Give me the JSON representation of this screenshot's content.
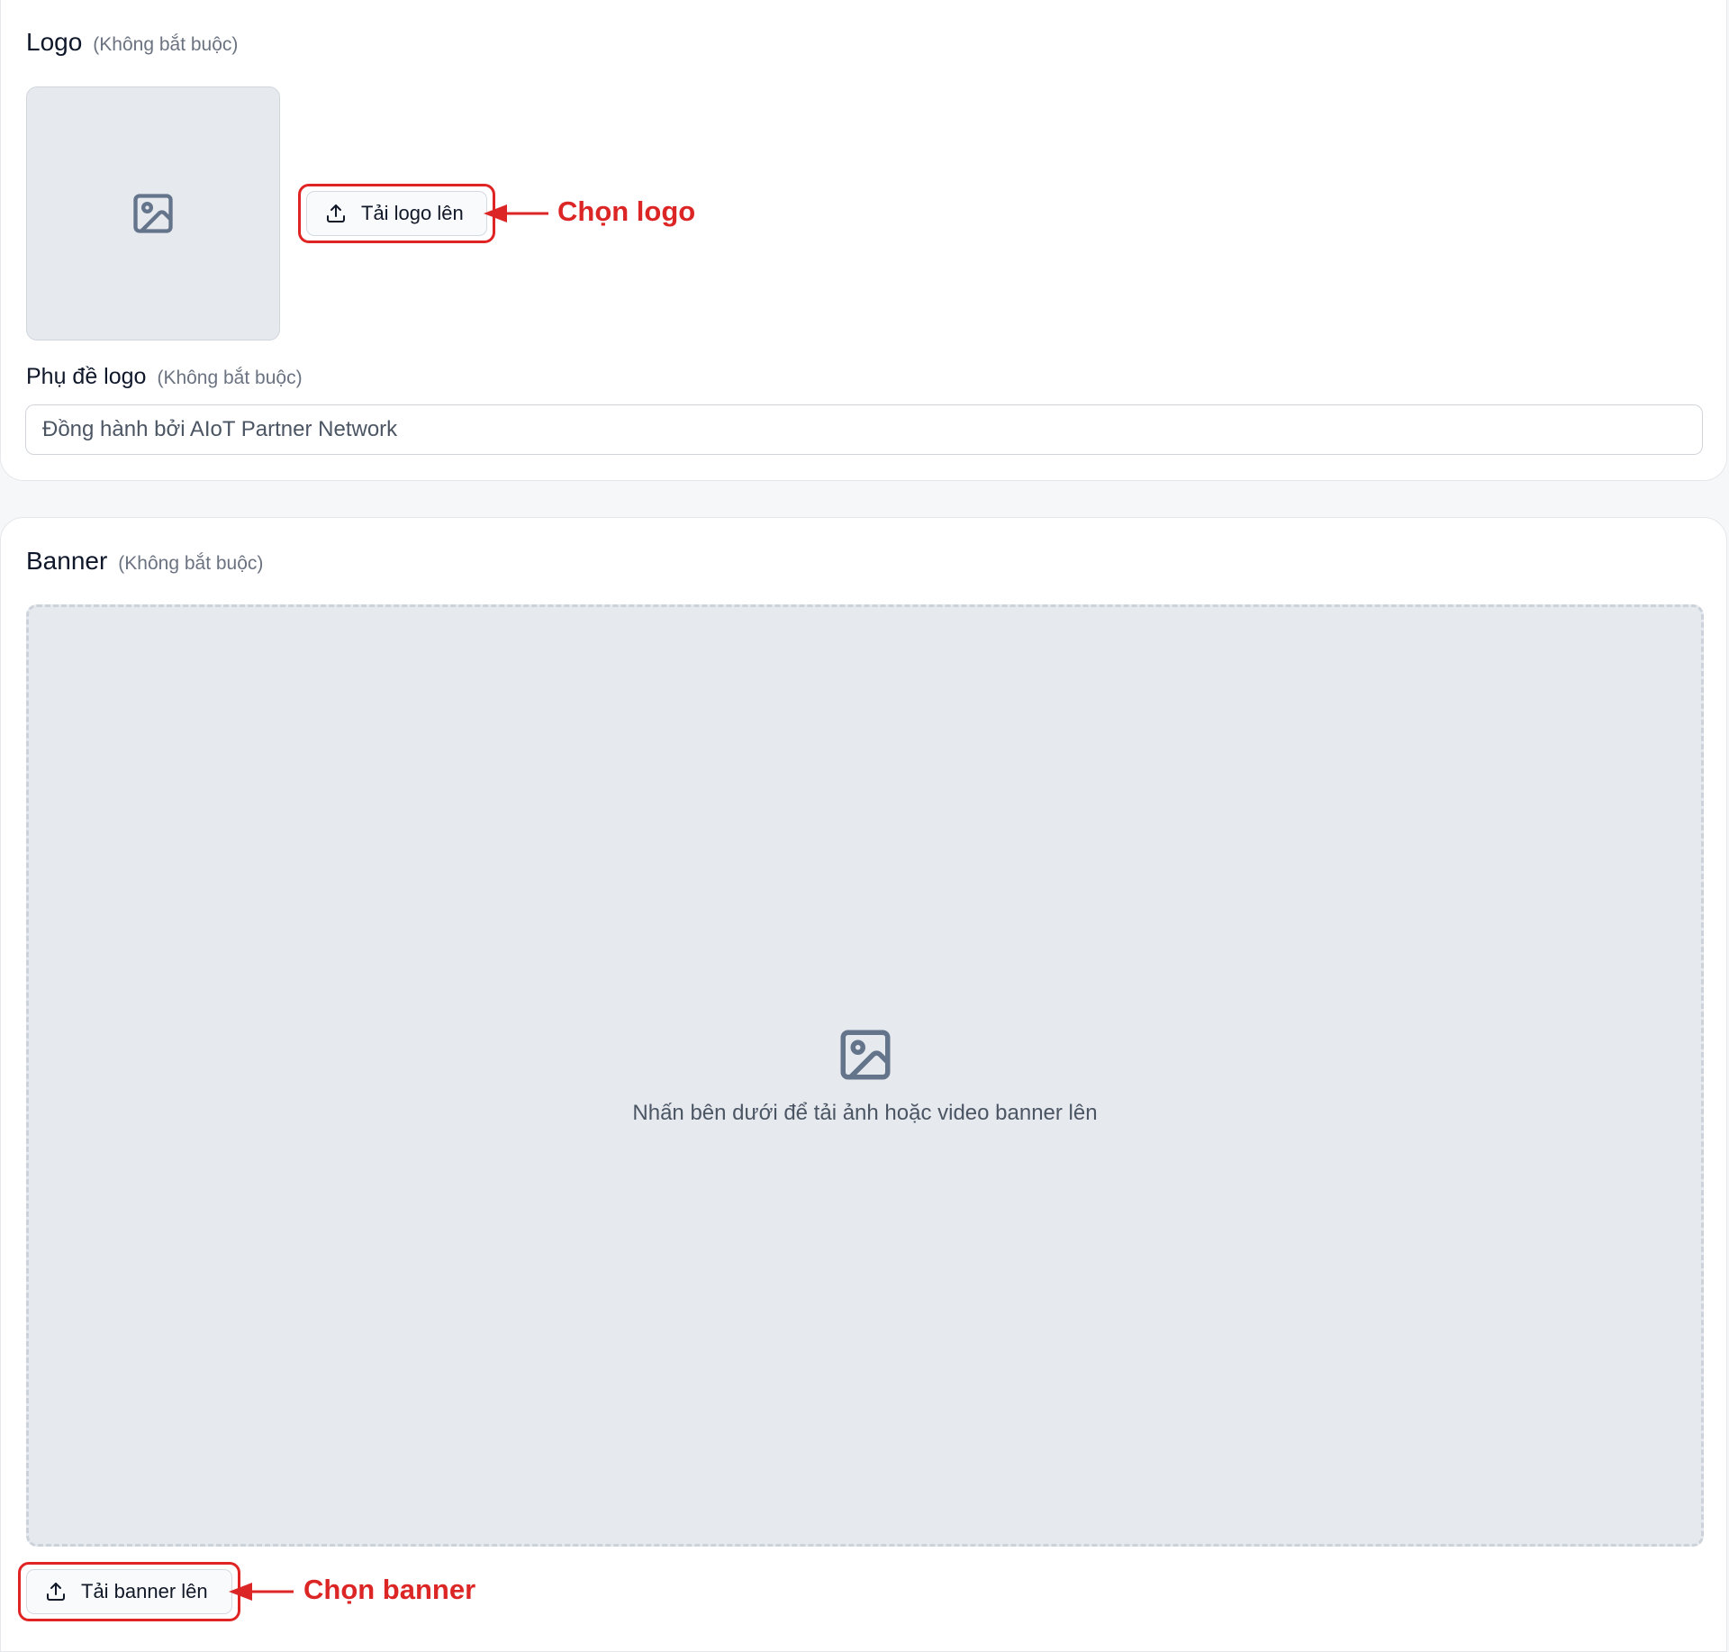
{
  "logo_section": {
    "title": "Logo",
    "optional": "(Không bắt buộc)",
    "upload_button": "Tải logo lên",
    "annotation": "Chọn logo",
    "preview_icon": "image-icon",
    "upload_icon": "upload-icon"
  },
  "subtitle_section": {
    "title": "Phụ đề logo",
    "optional": "(Không bắt buộc)",
    "input_value": "Đồng hành bởi AIoT Partner Network"
  },
  "banner_section": {
    "title": "Banner",
    "optional": "(Không bắt buộc)",
    "dropzone_text": "Nhấn bên dưới để tải ảnh hoặc video banner lên",
    "upload_button": "Tải banner lên",
    "annotation": "Chọn banner",
    "preview_icon": "image-icon"
  },
  "colors": {
    "annotation_red": "#dc2626",
    "placeholder_bg": "#e6eaef",
    "icon_gray": "#64748b"
  }
}
